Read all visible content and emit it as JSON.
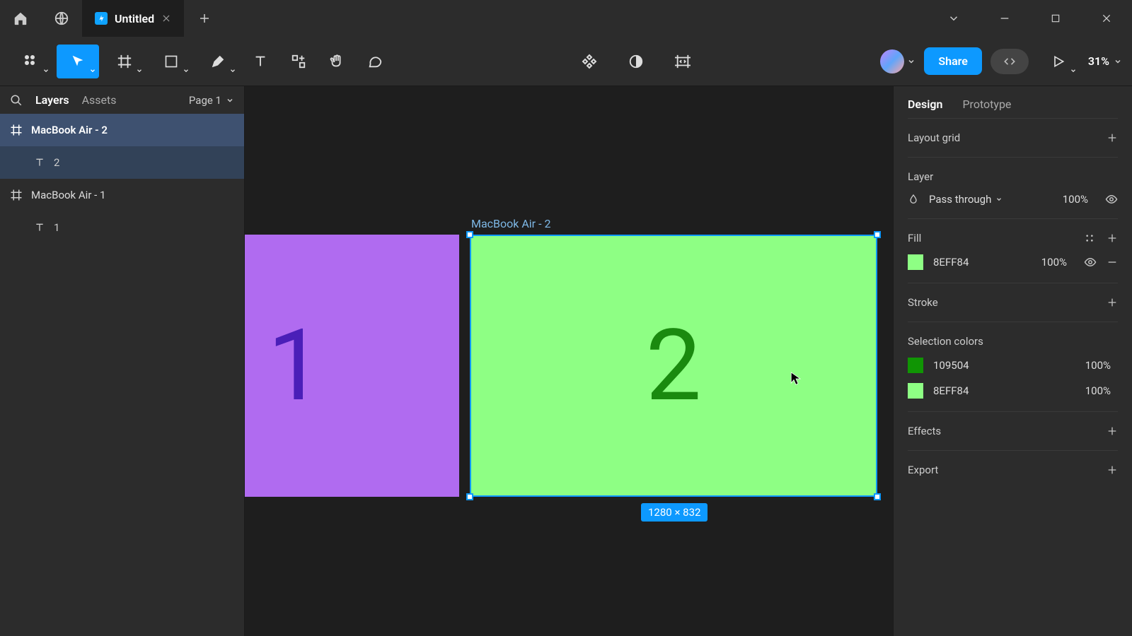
{
  "titlebar": {
    "tab_title": "Untitled"
  },
  "toolbar": {
    "share_label": "Share",
    "zoom": "31%"
  },
  "left_panel": {
    "search_placeholder": "Search",
    "tab_layers": "Layers",
    "tab_assets": "Assets",
    "page_label": "Page 1",
    "layers": [
      {
        "type": "frame",
        "name": "MacBook Air - 2",
        "selected": true
      },
      {
        "type": "text",
        "name": "2",
        "selected": true
      },
      {
        "type": "frame",
        "name": "MacBook Air - 1",
        "selected": false
      },
      {
        "type": "text",
        "name": "1",
        "selected": false
      }
    ]
  },
  "canvas": {
    "frame1": {
      "text": "1",
      "fill": "#b06bf0",
      "text_color": "#4a1fb8"
    },
    "frame2": {
      "label": "MacBook Air - 2",
      "text": "2",
      "fill": "#8eff84",
      "text_color": "#1a8a0f",
      "dimensions": "1280 × 832"
    }
  },
  "right_panel": {
    "tab_design": "Design",
    "tab_prototype": "Prototype",
    "layout_grid": "Layout grid",
    "layer": {
      "title": "Layer",
      "blend_mode": "Pass through",
      "opacity": "100%"
    },
    "fill": {
      "title": "Fill",
      "hex": "8EFF84",
      "opacity": "100%"
    },
    "stroke": {
      "title": "Stroke"
    },
    "selection_colors": {
      "title": "Selection colors",
      "items": [
        {
          "hex": "109504",
          "swatch": "#109504",
          "opacity": "100%"
        },
        {
          "hex": "8EFF84",
          "swatch": "#8eff84",
          "opacity": "100%"
        }
      ]
    },
    "effects": {
      "title": "Effects"
    },
    "export": {
      "title": "Export"
    }
  }
}
